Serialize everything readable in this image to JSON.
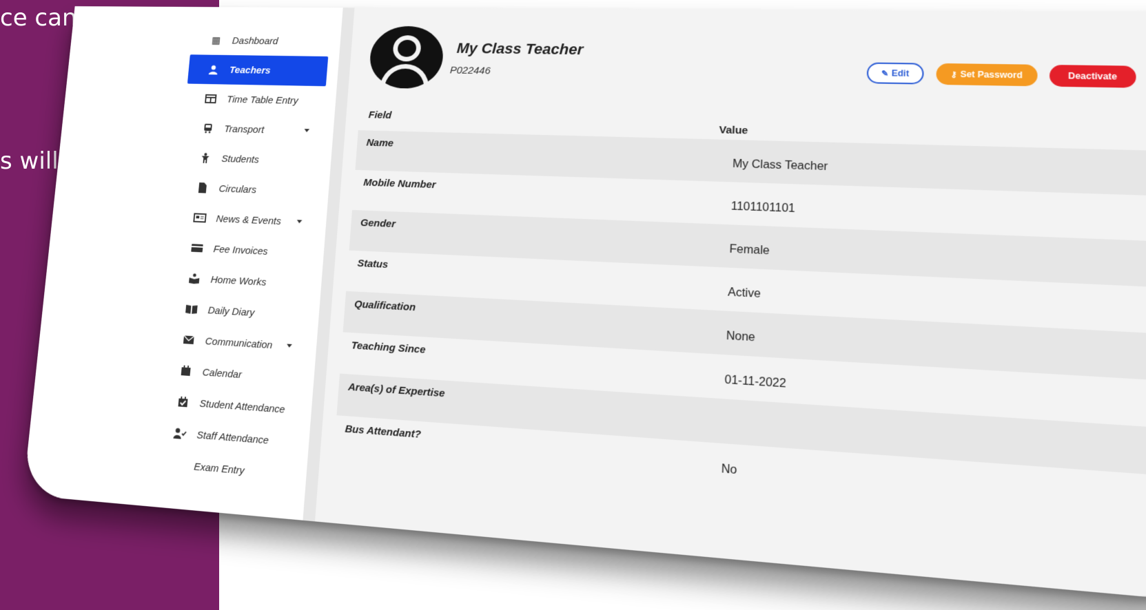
{
  "slide": {
    "line1": "ce can be",
    "line2": "s will",
    "bg_color": "#7a1f66"
  },
  "sidebar": {
    "items": [
      {
        "label": "Dashboard",
        "icon": "dashboard-icon"
      },
      {
        "label": "Teachers",
        "icon": "user-icon",
        "active": true
      },
      {
        "label": "Time Table Entry",
        "icon": "table-icon"
      },
      {
        "label": "Transport",
        "icon": "bus-icon",
        "has_caret": true
      },
      {
        "label": "Students",
        "icon": "child-icon"
      },
      {
        "label": "Circulars",
        "icon": "file-icon"
      },
      {
        "label": "News & Events",
        "icon": "newspaper-icon",
        "has_caret": true
      },
      {
        "label": "Fee Invoices",
        "icon": "credit-card-icon"
      },
      {
        "label": "Home Works",
        "icon": "book-reader-icon"
      },
      {
        "label": "Daily Diary",
        "icon": "open-book-icon"
      },
      {
        "label": "Communication",
        "icon": "envelope-icon",
        "has_caret": true
      },
      {
        "label": "Calendar",
        "icon": "calendar-icon"
      },
      {
        "label": "Student Attendance",
        "icon": "calendar-check-icon"
      },
      {
        "label": "Staff Attendance",
        "icon": "user-check-icon"
      },
      {
        "label": "Exam Entry",
        "icon": "exam-icon"
      }
    ]
  },
  "profile": {
    "name": "My Class Teacher",
    "id": "P022446"
  },
  "actions": {
    "edit": "Edit",
    "set_password": "Set Password",
    "deactivate": "Deactivate"
  },
  "table": {
    "header_field": "Field",
    "header_value": "Value",
    "rows": [
      {
        "field": "Name",
        "value": "My Class Teacher"
      },
      {
        "field": "Mobile Number",
        "value": "1101101101"
      },
      {
        "field": "Gender",
        "value": "Female"
      },
      {
        "field": "Status",
        "value": "Active"
      },
      {
        "field": "Qualification",
        "value": "None"
      },
      {
        "field": "Teaching Since",
        "value": "01-11-2022"
      },
      {
        "field": "Area(s) of Expertise",
        "value": ""
      },
      {
        "field": "Bus Attendant?",
        "value": "No"
      }
    ]
  },
  "colors": {
    "active_nav": "#1348e8",
    "edit_btn": "#2f5fd6",
    "set_password_btn": "#f59a22",
    "deactivate_btn": "#e4202a"
  }
}
